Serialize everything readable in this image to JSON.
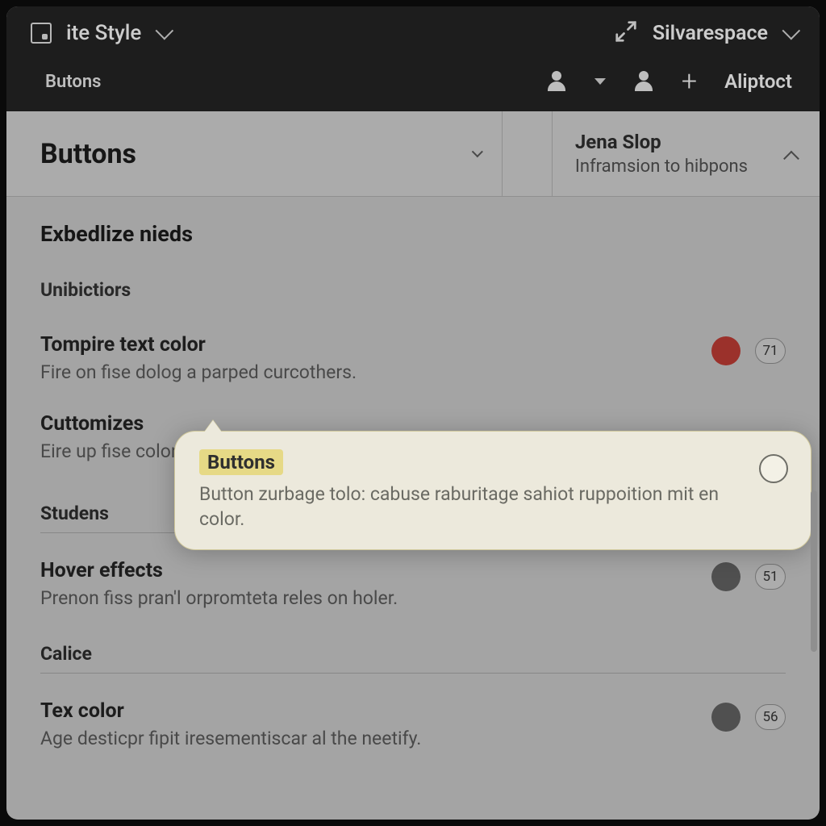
{
  "topbar": {
    "site_style": "ite Style",
    "brand": "Silvarespace"
  },
  "subbar": {
    "left": "Butons",
    "right_label": "Aliptoct"
  },
  "titlebar": {
    "title": "Buttons",
    "jena_title": "Jena Slop",
    "jena_sub": "Inframsion to hibpons"
  },
  "content": {
    "section_heading": "Exbedlize nieds",
    "group1_label": "Unibictiors",
    "rows": [
      {
        "title": "Tompire text color",
        "desc": "Fire on fise dolog a parped curcothers.",
        "swatch": "#b53a33",
        "value": "71"
      },
      {
        "title": "Cuttomizes",
        "desc": "Eire up fise color"
      }
    ],
    "group2_label": "Studens",
    "row_hover": {
      "title": "Hover effects",
      "desc": "Prenon fiss pran'l orpromteta reles on holer.",
      "swatch": "#5e5e5e",
      "value": "51"
    },
    "group3_label": "Calice",
    "row_tex": {
      "title": "Tex color",
      "desc": "Age desticpr fipit iresementiscar al the neetify.",
      "swatch": "#5e5e5e",
      "value": "56"
    }
  },
  "callout": {
    "title": "Buttons",
    "desc": "Button zurbage tolo: cabuse raburitage sahiot ruppoition mit en color."
  }
}
